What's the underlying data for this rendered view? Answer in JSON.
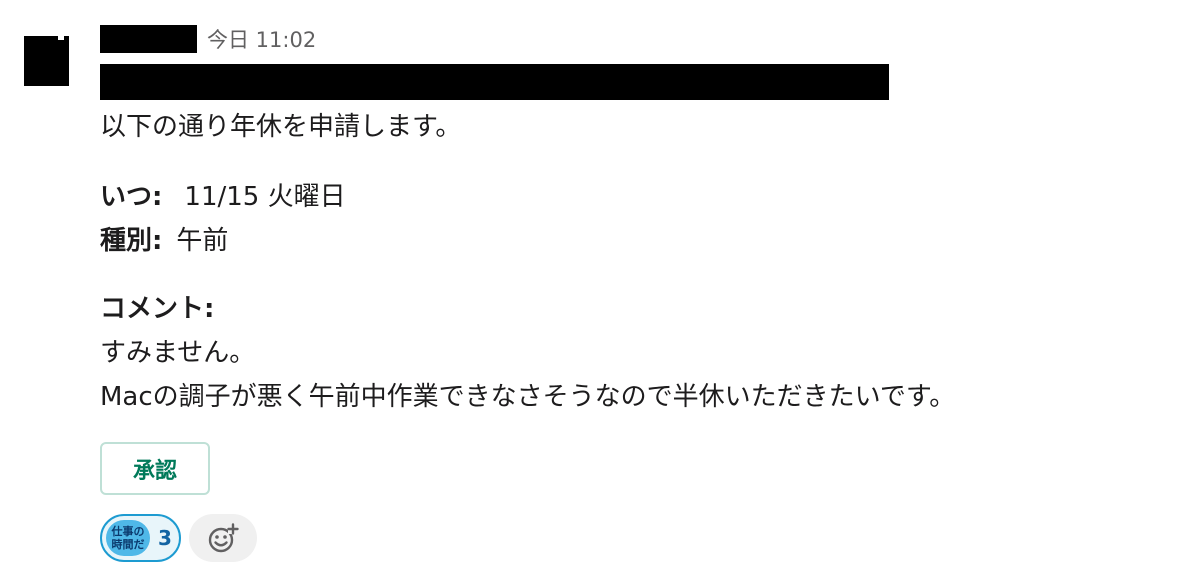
{
  "message": {
    "timestamp": "今日 11:02",
    "intro": "以下の通り年休を申請します。",
    "when": {
      "label": "いつ:",
      "value": "11/15 火曜日"
    },
    "type": {
      "label": "種別:",
      "value": "午前"
    },
    "comment": {
      "label": "コメント:",
      "line1": "すみません。",
      "line2": "Macの調子が悪く午前中作業できなさそうなので半休いただきたいです。"
    },
    "approve_button": "承認",
    "reaction": {
      "emoji_name": "仕事の時間だ",
      "emoji_text_line1": "仕事の",
      "emoji_text_line2": "時間だ",
      "count": "3"
    },
    "add_reaction_icon": "add-emoji-icon"
  },
  "colors": {
    "approve_text": "#007a5a",
    "approve_border": "#bfe0d6",
    "reaction_border": "#1d9bd1",
    "reaction_bg": "#e8f5fa",
    "reaction_count": "#1264a3",
    "timestamp": "#616061"
  }
}
